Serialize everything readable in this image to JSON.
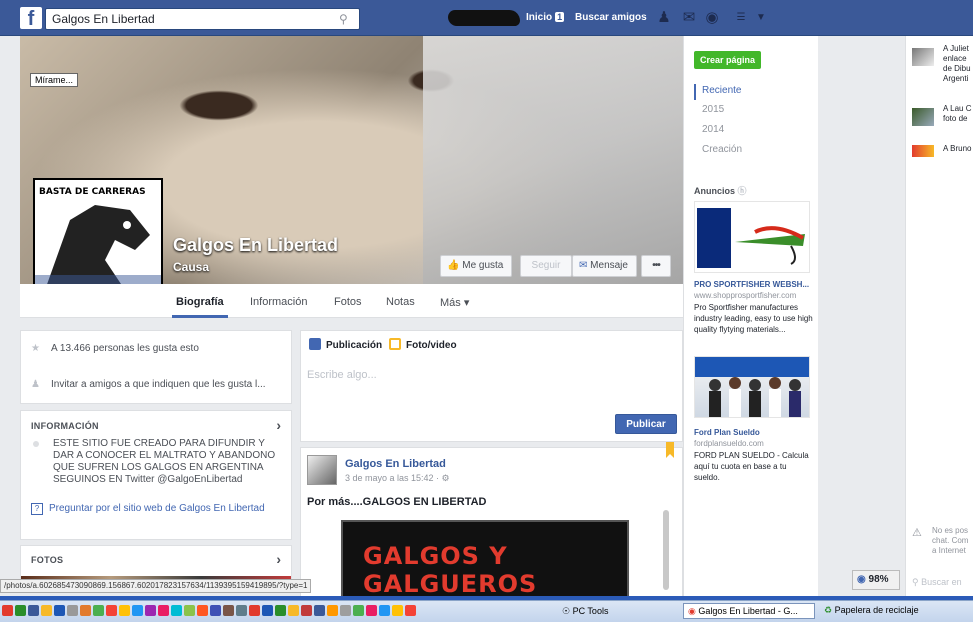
{
  "topbar": {
    "search_value": "Galgos En Libertad",
    "home_label": "Inicio",
    "home_count": "1",
    "find_friends_label": "Buscar amigos"
  },
  "cover": {
    "mirame_label": "Mírame...",
    "page_name": "Galgos En Libertad",
    "page_category": "Causa",
    "like_label": "Me gusta",
    "follow_label": "Seguir",
    "message_label": "Mensaje",
    "more_dots": "•••",
    "profile_text": "BASTA DE CARRERAS"
  },
  "tabs": [
    "Biografía",
    "Información",
    "Fotos",
    "Notas",
    "Más ▾"
  ],
  "left": {
    "likes_text": "A 13.466 personas les gusta esto",
    "invite_text": "Invitar a amigos a que indiquen que les gusta l...",
    "info_title": "INFORMACIÓN",
    "description": "ESTE SITIO FUE CREADO PARA DIFUNDIR Y DAR A CONOCER EL MALTRATO Y ABANDONO QUE SUFREN LOS GALGOS EN ARGENTINA SEGUINOS EN Twitter @GalgoEnLibertad",
    "website_link": "Preguntar por el sitio web de Galgos En Libertad",
    "photos_title": "FOTOS"
  },
  "composer": {
    "tab_post": "Publicación",
    "tab_photo": "Foto/video",
    "placeholder": "Escribe algo...",
    "publish_label": "Publicar"
  },
  "post": {
    "author": "Galgos En Libertad",
    "time": "3 de mayo a las 15:42 · ⚙",
    "text": "Por más....GALGOS EN LIBERTAD",
    "image_title": "GALGOS Y GALGUEROS"
  },
  "timeline": {
    "create_page": "Crear página",
    "years": [
      "Reciente",
      "2015",
      "2014",
      "Creación"
    ]
  },
  "ads": {
    "title": "Anuncios",
    "items": [
      {
        "title": "PRO SPORTFISHER WEBSH...",
        "url": "www.shopprosportfisher.com",
        "desc": "Pro Sportfisher manufactures industry leading, easy to use high quality flytying materials..."
      },
      {
        "title": "Ford Plan Sueldo",
        "url": "fordplansueldo.com",
        "desc": "FORD PLAN SUELDO - Calcula aquí tu cuota en base a tu sueldo."
      }
    ]
  },
  "ticker": [
    {
      "text": "A Juliet\nenlace\nde Dibu\nArgenti"
    },
    {
      "text": "A Lau C\nfoto de"
    },
    {
      "text": "A Bruno"
    }
  ],
  "chat": {
    "offline_text": "No es pos\nchat. Com\na Internet",
    "search_placeholder": "Buscar en"
  },
  "browser": {
    "zoom": "98%",
    "status_url": "/photos/a.602685473090869.156867.602017823157634/1139395159419895/?type=1"
  },
  "taskbar": {
    "pctools": "PC Tools",
    "task_browser": "Galgos En Libertad - G...",
    "task_recycle": "Papelera de reciclaje"
  },
  "colors": {
    "facebook_blue": "#3b5998",
    "button_blue": "#4267b2",
    "green": "#42b72a"
  }
}
